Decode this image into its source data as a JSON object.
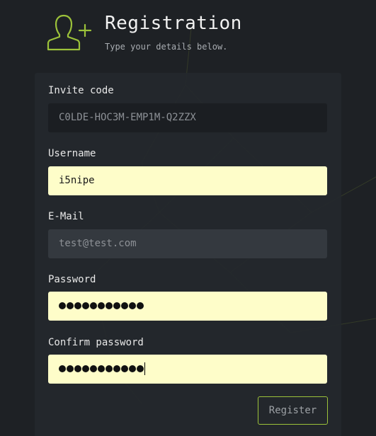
{
  "header": {
    "title": "Registration",
    "subtitle": "Type your details below.",
    "icon": "add-user-icon"
  },
  "form": {
    "invite": {
      "label": "Invite code",
      "value": "C0LDE-HOC3M-EMP1M-Q2ZZX"
    },
    "username": {
      "label": "Username",
      "value": "i5nipe"
    },
    "email": {
      "label": "E-Mail",
      "placeholder": "test@test.com"
    },
    "password": {
      "label": "Password",
      "masked_length": 11
    },
    "confirm_password": {
      "label": "Confirm password",
      "masked_length": 11
    },
    "register_label": "Register"
  },
  "colors": {
    "background": "#1e2125",
    "panel": "#24282d",
    "accent": "#9cc23a",
    "autofill": "#fefdc9"
  }
}
